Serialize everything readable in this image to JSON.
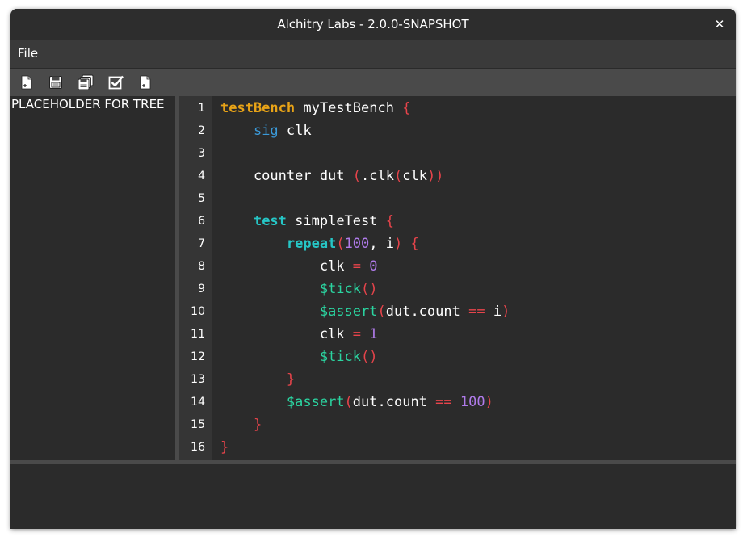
{
  "window": {
    "title": "Alchitry Labs - 2.0.0-SNAPSHOT",
    "close_glyph": "✕"
  },
  "menubar": {
    "items": [
      {
        "label": "File"
      }
    ]
  },
  "toolbar": {
    "buttons": [
      {
        "name": "new-file-icon"
      },
      {
        "name": "save-icon"
      },
      {
        "name": "save-all-icon"
      },
      {
        "name": "check-icon"
      },
      {
        "name": "new-test-file-icon"
      }
    ]
  },
  "tree": {
    "placeholder": "PLACEHOLDER FOR TREE"
  },
  "colors": {
    "keyword_orange": "#e8a317",
    "keyword_blue": "#3b9ad9",
    "keyword_cyan": "#26c6c6",
    "function_green": "#2bd4a0",
    "number_purple": "#b07bea",
    "bracket_red": "#e8444b",
    "text": "#ffffff"
  },
  "editor": {
    "lines": [
      {
        "n": "1",
        "tokens": [
          {
            "t": "testBench",
            "c": "keyword_orange",
            "b": true
          },
          {
            "t": " myTestBench "
          },
          {
            "t": "{",
            "c": "bracket_red"
          }
        ]
      },
      {
        "n": "2",
        "tokens": [
          {
            "t": "    "
          },
          {
            "t": "sig",
            "c": "keyword_blue"
          },
          {
            "t": " clk"
          }
        ]
      },
      {
        "n": "3",
        "tokens": []
      },
      {
        "n": "4",
        "tokens": [
          {
            "t": "    counter dut "
          },
          {
            "t": "(",
            "c": "bracket_red"
          },
          {
            "t": ".clk"
          },
          {
            "t": "(",
            "c": "bracket_red"
          },
          {
            "t": "clk"
          },
          {
            "t": "))",
            "c": "bracket_red"
          }
        ]
      },
      {
        "n": "5",
        "tokens": []
      },
      {
        "n": "6",
        "tokens": [
          {
            "t": "    "
          },
          {
            "t": "test",
            "c": "keyword_cyan",
            "b": true
          },
          {
            "t": " simpleTest "
          },
          {
            "t": "{",
            "c": "bracket_red"
          }
        ]
      },
      {
        "n": "7",
        "tokens": [
          {
            "t": "        "
          },
          {
            "t": "repeat",
            "c": "keyword_cyan",
            "b": true
          },
          {
            "t": "(",
            "c": "bracket_red"
          },
          {
            "t": "100",
            "c": "number_purple"
          },
          {
            "t": ", i"
          },
          {
            "t": ")",
            "c": "bracket_red"
          },
          {
            "t": " "
          },
          {
            "t": "{",
            "c": "bracket_red"
          }
        ]
      },
      {
        "n": "8",
        "tokens": [
          {
            "t": "            clk "
          },
          {
            "t": "=",
            "c": "bracket_red"
          },
          {
            "t": " "
          },
          {
            "t": "0",
            "c": "number_purple"
          }
        ]
      },
      {
        "n": "9",
        "tokens": [
          {
            "t": "            "
          },
          {
            "t": "$tick",
            "c": "function_green"
          },
          {
            "t": "()",
            "c": "bracket_red"
          }
        ]
      },
      {
        "n": "10",
        "tokens": [
          {
            "t": "            "
          },
          {
            "t": "$assert",
            "c": "function_green"
          },
          {
            "t": "(",
            "c": "bracket_red"
          },
          {
            "t": "dut.count "
          },
          {
            "t": "==",
            "c": "bracket_red"
          },
          {
            "t": " i"
          },
          {
            "t": ")",
            "c": "bracket_red"
          }
        ]
      },
      {
        "n": "11",
        "tokens": [
          {
            "t": "            clk "
          },
          {
            "t": "=",
            "c": "bracket_red"
          },
          {
            "t": " "
          },
          {
            "t": "1",
            "c": "number_purple"
          }
        ]
      },
      {
        "n": "12",
        "tokens": [
          {
            "t": "            "
          },
          {
            "t": "$tick",
            "c": "function_green"
          },
          {
            "t": "()",
            "c": "bracket_red"
          }
        ]
      },
      {
        "n": "13",
        "tokens": [
          {
            "t": "        "
          },
          {
            "t": "}",
            "c": "bracket_red"
          }
        ]
      },
      {
        "n": "14",
        "tokens": [
          {
            "t": "        "
          },
          {
            "t": "$assert",
            "c": "function_green"
          },
          {
            "t": "(",
            "c": "bracket_red"
          },
          {
            "t": "dut.count "
          },
          {
            "t": "==",
            "c": "bracket_red"
          },
          {
            "t": " "
          },
          {
            "t": "100",
            "c": "number_purple"
          },
          {
            "t": ")",
            "c": "bracket_red"
          }
        ]
      },
      {
        "n": "15",
        "tokens": [
          {
            "t": "    "
          },
          {
            "t": "}",
            "c": "bracket_red"
          }
        ]
      },
      {
        "n": "16",
        "tokens": [
          {
            "t": "}",
            "c": "bracket_red"
          }
        ]
      }
    ]
  }
}
